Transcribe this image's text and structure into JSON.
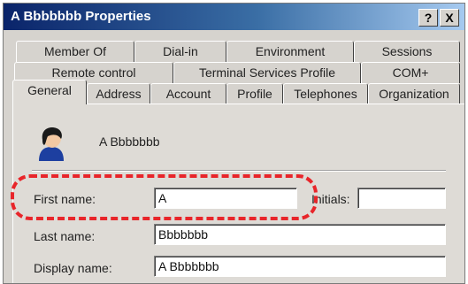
{
  "window": {
    "title": "A Bbbbbbb Properties",
    "help_label": "?",
    "close_label": "X"
  },
  "tabs": {
    "row1": [
      "Member Of",
      "Dial-in",
      "Environment",
      "Sessions"
    ],
    "row2": [
      "Remote control",
      "Terminal Services Profile",
      "COM+"
    ],
    "row3": [
      "General",
      "Address",
      "Account",
      "Profile",
      "Telephones",
      "Organization"
    ],
    "active": "General"
  },
  "general": {
    "display": "A Bbbbbbb",
    "first_name_label": "First name:",
    "first_name_value": "A",
    "initials_label": "Initials:",
    "initials_value": "",
    "last_name_label": "Last name:",
    "last_name_value": "Bbbbbbb",
    "display_name_label": "Display name:",
    "display_name_value": "A Bbbbbbb"
  },
  "icons": {
    "user": "user-icon",
    "help": "help-icon",
    "close": "close-icon"
  },
  "colors": {
    "highlight": "#e8252a",
    "titlebar": "#0a246a"
  }
}
